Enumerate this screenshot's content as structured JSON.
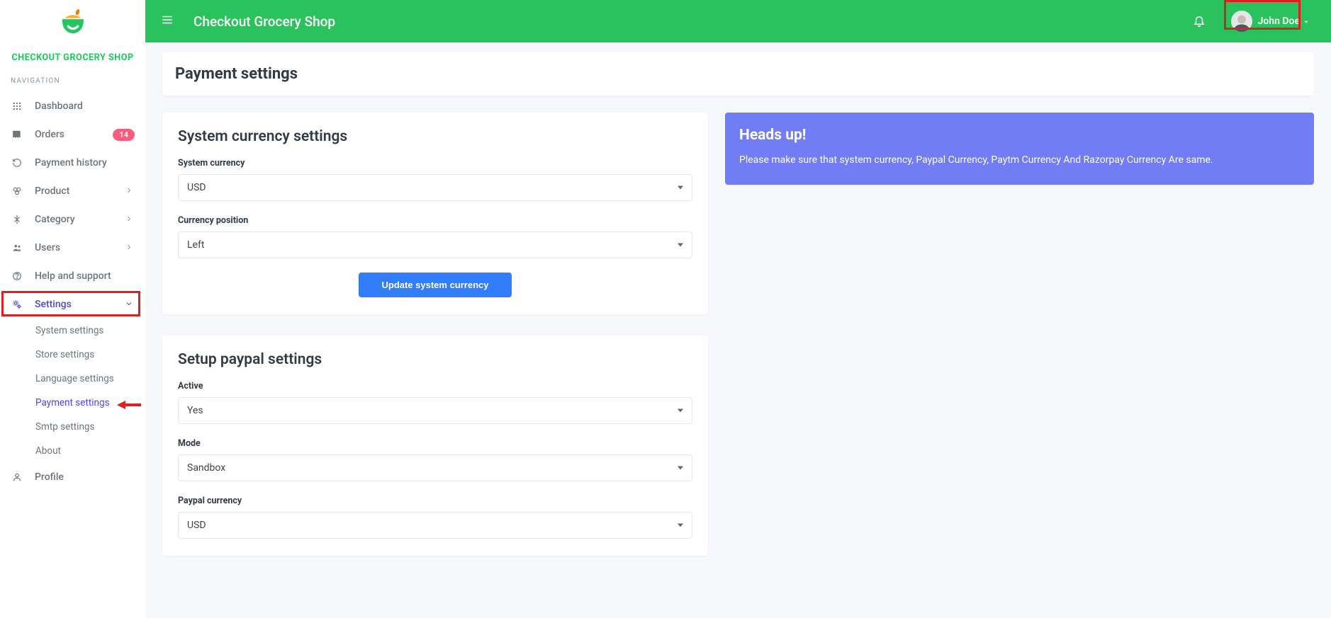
{
  "brand": "CHECKOUT GROCERY SHOP",
  "app_title": "Checkout Grocery Shop",
  "user_name": "John Doe",
  "nav_section": "NAVIGATION",
  "sidebar": {
    "dashboard": "Dashboard",
    "orders": "Orders",
    "orders_badge": "14",
    "payment_history": "Payment history",
    "product": "Product",
    "category": "Category",
    "users": "Users",
    "help": "Help and support",
    "settings": "Settings",
    "profile": "Profile",
    "subs": {
      "system": "System settings",
      "store": "Store settings",
      "language": "Language settings",
      "payment": "Payment settings",
      "smtp": "Smtp settings",
      "about": "About"
    }
  },
  "page_title": "Payment settings",
  "card1": {
    "title": "System currency settings",
    "label_currency": "System currency",
    "value_currency": "USD",
    "label_position": "Currency position",
    "value_position": "Left",
    "button": "Update system currency"
  },
  "card2": {
    "title": "Setup paypal settings",
    "label_active": "Active",
    "value_active": "Yes",
    "label_mode": "Mode",
    "value_mode": "Sandbox",
    "label_currency": "Paypal currency",
    "value_currency": "USD"
  },
  "alert": {
    "title": "Heads up!",
    "text": "Please make sure that system currency, Paypal Currency, Paytm Currency And Razorpay Currency Are same."
  }
}
